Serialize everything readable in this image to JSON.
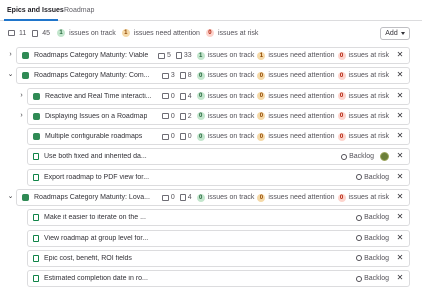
{
  "tabs": [
    {
      "label": "Epics and Issues",
      "active": true
    },
    {
      "label": "Roadmap",
      "active": false
    }
  ],
  "summary": {
    "epic_count": "11",
    "issue_count": "45",
    "on_track_count": "1",
    "on_track_label": "issues on track",
    "attention_count": "1",
    "attention_label": "issues need attention",
    "risk_count": "0",
    "risk_label": "issues at risk"
  },
  "add_button": "Add",
  "rows": [
    {
      "type": "epic",
      "expanded": false,
      "title": "Roadmaps Category Maturity: Viable",
      "epics": "5",
      "issues": "33",
      "on_track": "1",
      "on_track_label": "issues on track",
      "attention": "1",
      "attention_label": "issues need attention",
      "risk": "0",
      "risk_label": "issues at risk"
    },
    {
      "type": "epic",
      "expanded": true,
      "title": "Roadmaps Category Maturity: Com...",
      "epics": "3",
      "issues": "8",
      "on_track": "0",
      "on_track_label": "issues on track",
      "attention": "0",
      "attention_label": "issues need attention",
      "risk": "0",
      "risk_label": "issues at risk"
    },
    {
      "type": "epic",
      "expanded": false,
      "title": "Reactive and Real Time interacti...",
      "epics": "0",
      "issues": "4",
      "on_track": "0",
      "on_track_label": "issues on track",
      "attention": "0",
      "attention_label": "issues need attention",
      "risk": "0",
      "risk_label": "issues at risk"
    },
    {
      "type": "epic",
      "expanded": false,
      "title": "Displaying Issues on a Roadmap",
      "epics": "0",
      "issues": "2",
      "on_track": "0",
      "on_track_label": "issues on track",
      "attention": "0",
      "attention_label": "issues need attention",
      "risk": "0",
      "risk_label": "issues at risk"
    },
    {
      "type": "epic",
      "expanded": null,
      "title": "Multiple configurable roadmaps",
      "epics": "0",
      "issues": "0",
      "on_track": "0",
      "on_track_label": "issues on track",
      "attention": "0",
      "attention_label": "issues need attention",
      "risk": "0",
      "risk_label": "issues at risk"
    },
    {
      "type": "issue",
      "title": "Use both fixed and inherited da...",
      "status": "Backlog",
      "avatar": true
    },
    {
      "type": "issue",
      "title": "Export roadmap to PDF view for...",
      "status": "Backlog",
      "avatar": false
    },
    {
      "type": "epic",
      "expanded": true,
      "title": "Roadmaps Category Maturity: Lova...",
      "epics": "0",
      "issues": "4",
      "on_track": "0",
      "on_track_label": "issues on track",
      "attention": "0",
      "attention_label": "issues need attention",
      "risk": "0",
      "risk_label": "issues at risk"
    },
    {
      "type": "issue",
      "title": "Make it easier to iterate on the ...",
      "status": "Backlog",
      "avatar": false
    },
    {
      "type": "issue",
      "title": "View roadmap at group level for...",
      "status": "Backlog",
      "avatar": false
    },
    {
      "type": "issue",
      "title": "Epic cost, benefit, ROI fields",
      "status": "Backlog",
      "avatar": false
    },
    {
      "type": "issue",
      "title": "Estimated completion date in ro...",
      "status": "Backlog",
      "avatar": false
    }
  ]
}
